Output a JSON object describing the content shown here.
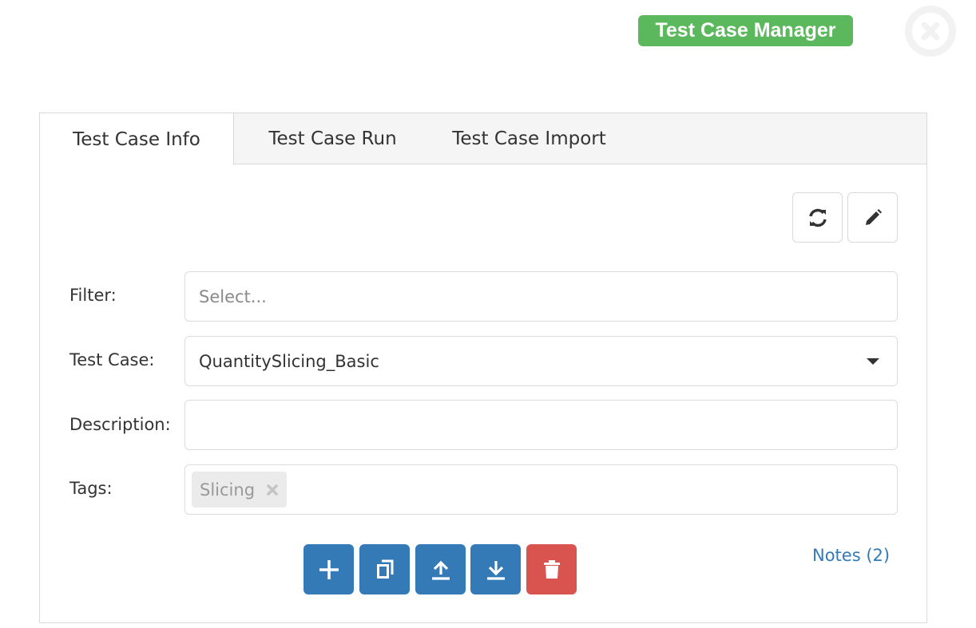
{
  "header": {
    "app_title": "Test Case Manager",
    "close_icon": "circle-x-icon"
  },
  "tabs": [
    {
      "label": "Test Case Info",
      "active": true
    },
    {
      "label": "Test Case Run",
      "active": false
    },
    {
      "label": "Test Case Import",
      "active": false
    }
  ],
  "toolbar": {
    "refresh_icon": "refresh-icon",
    "edit_icon": "pencil-icon"
  },
  "form": {
    "filter": {
      "label": "Filter:",
      "value": "",
      "placeholder": "Select..."
    },
    "test_case": {
      "label": "Test Case:",
      "value": "QuantitySlicing_Basic"
    },
    "description": {
      "label": "Description:",
      "value": ""
    },
    "tags": {
      "label": "Tags:",
      "items": [
        "Slicing"
      ]
    }
  },
  "actions": [
    {
      "name": "add",
      "icon": "plus-icon"
    },
    {
      "name": "copy",
      "icon": "copy-icon"
    },
    {
      "name": "upload",
      "icon": "upload-icon"
    },
    {
      "name": "download",
      "icon": "download-icon"
    },
    {
      "name": "delete",
      "icon": "trash-icon"
    }
  ],
  "notes": {
    "label": "Notes (2)"
  },
  "colors": {
    "brand_green": "#5cb85c",
    "primary_blue": "#337ab7",
    "danger_red": "#d9534f"
  }
}
